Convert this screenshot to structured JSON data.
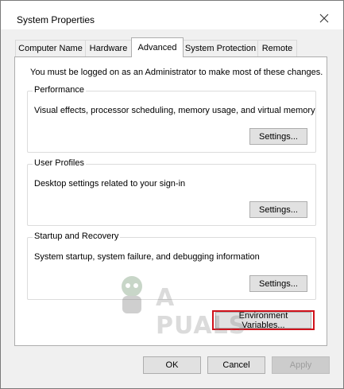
{
  "window": {
    "title": "System Properties"
  },
  "tabs": [
    {
      "label": "Computer Name",
      "active": false
    },
    {
      "label": "Hardware",
      "active": false
    },
    {
      "label": "Advanced",
      "active": true
    },
    {
      "label": "System Protection",
      "active": false
    },
    {
      "label": "Remote",
      "active": false
    }
  ],
  "advanced": {
    "notice": "You must be logged on as an Administrator to make most of these changes.",
    "performance": {
      "label": "Performance",
      "description": "Visual effects, processor scheduling, memory usage, and virtual memory",
      "button": "Settings..."
    },
    "user_profiles": {
      "label": "User Profiles",
      "description": "Desktop settings related to your sign-in",
      "button": "Settings..."
    },
    "startup_recovery": {
      "label": "Startup and Recovery",
      "description": "System startup, system failure, and debugging information",
      "button": "Settings..."
    },
    "env_button": "Environment Variables..."
  },
  "footer": {
    "ok": "OK",
    "cancel": "Cancel",
    "apply": "Apply"
  },
  "watermark": {
    "text": "A PUALS"
  },
  "colors": {
    "highlight": "#d0121b",
    "panel_bg": "#ffffff",
    "window_bg": "#f0f0f0"
  }
}
